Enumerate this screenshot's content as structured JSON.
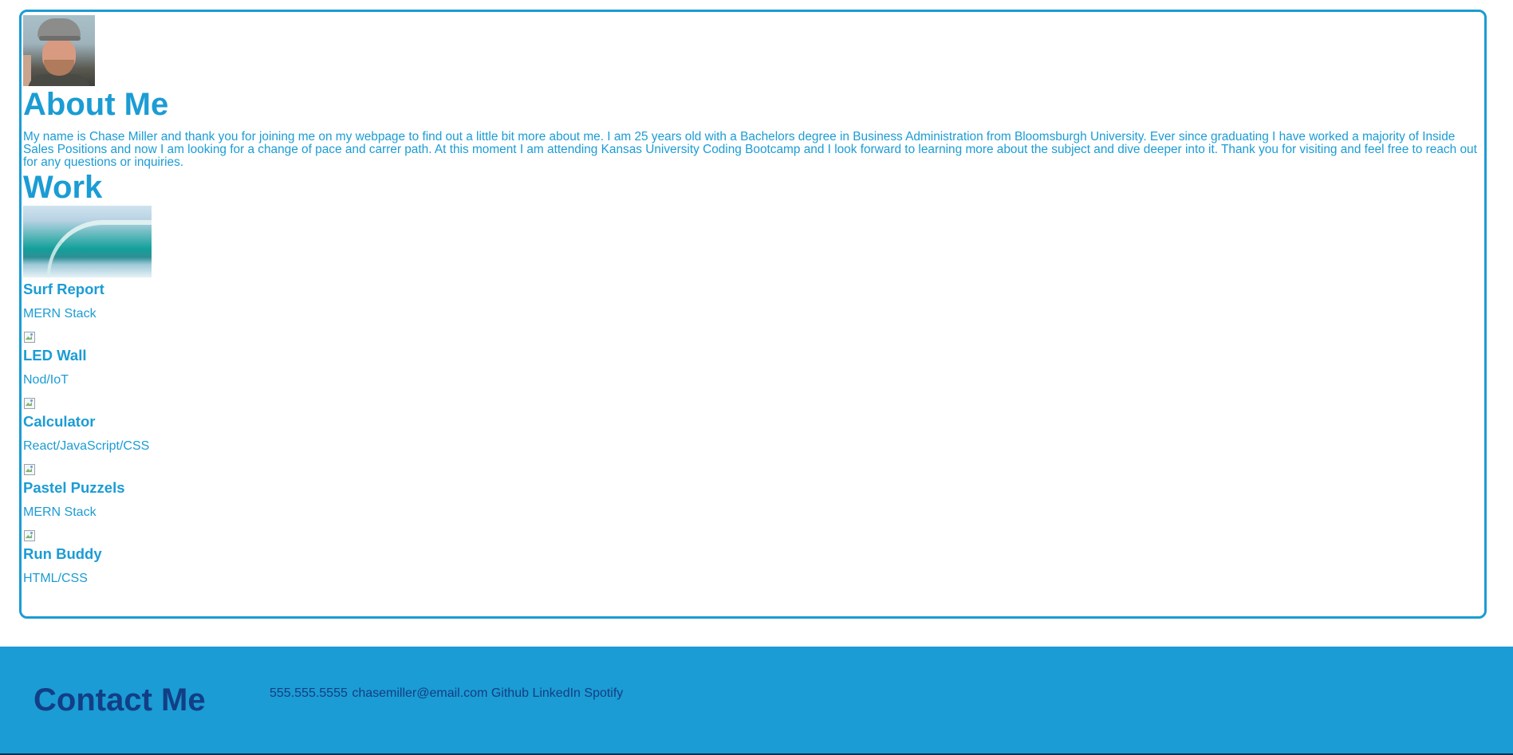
{
  "about": {
    "title": "About Me",
    "text": "My name is Chase Miller and thank you for joining me on my webpage to find out a little bit more about me. I am 25 years old with a Bachelors degree in Business Administration from Bloomsburgh University. Ever since graduating I have worked a majority of Inside Sales Positions and now I am looking for a change of pace and carrer path. At this moment I am attending Kansas University Coding Bootcamp and I look forward to learning more about the subject and dive deeper into it. Thank you for visiting and feel free to reach out for any questions or inquiries."
  },
  "work": {
    "title": "Work",
    "projects": [
      {
        "name": "Surf Report",
        "stack": "MERN Stack"
      },
      {
        "name": "LED Wall",
        "stack": "Nod/IoT"
      },
      {
        "name": "Calculator",
        "stack": "React/JavaScript/CSS"
      },
      {
        "name": "Pastel Puzzels",
        "stack": "MERN Stack"
      },
      {
        "name": "Run Buddy",
        "stack": "HTML/CSS"
      }
    ]
  },
  "contact": {
    "title": "Contact Me",
    "phone": "555.555.5555",
    "email": "chasemiller@email.com",
    "github": "Github",
    "linkedin": "LinkedIn",
    "spotify": "Spotify"
  },
  "colors": {
    "accent": "#1b9cd4",
    "footer_text": "#123e85",
    "background": "#ffffff"
  }
}
